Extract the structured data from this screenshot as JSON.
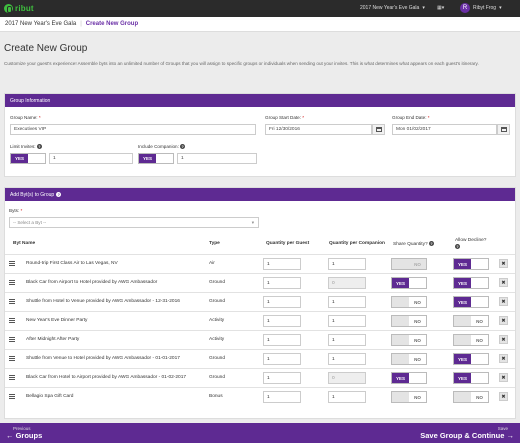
{
  "header": {
    "logo_text": "ribut",
    "event_selector": "2017 New Year's Eve Gala",
    "user_name": "Ribyt Frog",
    "user_initial": "R"
  },
  "breadcrumb": {
    "parent": "2017 New Year's Eve Gala",
    "current": "Create New Group"
  },
  "page": {
    "title": "Create New Group",
    "intro": "Customize your guest's experience! Assemble byts into an unlimited number of Groups that you will assign to specific groups or individuals when sending out your invites. This is what determines what appears on each guest's itinerary."
  },
  "group_info": {
    "heading": "Group Information",
    "name_label": "Group Name:",
    "name_value": "Executives VIP",
    "start_label": "Group Start Date:",
    "start_value": "Fri 12/30/2016",
    "end_label": "Group End Date:",
    "end_value": "Mon 01/02/2017",
    "limit_label": "Limit Invites:",
    "limit_toggle": "YES",
    "limit_value": "1",
    "companion_label": "Include Companion:",
    "companion_toggle": "YES",
    "companion_value": "1",
    "required_mark": "*"
  },
  "byts": {
    "heading": "Add Byt(s) to Group",
    "select_label": "Byts:",
    "select_placeholder": "-- Select a Byt --",
    "columns": {
      "name": "Byt Name",
      "type": "Type",
      "qty_guest": "Quantity per Guest",
      "qty_companion": "Quantity per Companion",
      "share": "Share Quantity?",
      "decline": "Allow Decline?"
    },
    "yes_label": "YES",
    "no_label": "NO",
    "rows": [
      {
        "name": "Round-trip First Class Air to Las Vegas, NV",
        "type": "Air",
        "qty_guest": "1",
        "qty_companion": "1"
      },
      {
        "name": "Black Car from Airport to Hotel provided by AWG Ambassador",
        "type": "Ground",
        "qty_guest": "1",
        "qty_companion": "0"
      },
      {
        "name": "Shuttle from Hotel to Venue provided by AWG Ambassador - 12-31-2016",
        "type": "Ground",
        "qty_guest": "1",
        "qty_companion": "1"
      },
      {
        "name": "New Year's Eve Dinner Party",
        "type": "Activity",
        "qty_guest": "1",
        "qty_companion": "1"
      },
      {
        "name": "After Midnight After Party",
        "type": "Activity",
        "qty_guest": "1",
        "qty_companion": "1"
      },
      {
        "name": "Shuttle from Venue to Hotel provided by AWG Ambassador - 01-01-2017",
        "type": "Ground",
        "qty_guest": "1",
        "qty_companion": "1"
      },
      {
        "name": "Black Car from Hotel to Airport provided by AWG Ambassador - 01-02-2017",
        "type": "Ground",
        "qty_guest": "1",
        "qty_companion": "0"
      },
      {
        "name": "Bellagio Spa Gift Card",
        "type": "Bonus",
        "qty_guest": "1",
        "qty_companion": "1"
      }
    ]
  },
  "footer": {
    "prev_small": "Previous",
    "prev_big": "Groups",
    "next_small": "Save",
    "next_big": "Save Group & Continue"
  }
}
